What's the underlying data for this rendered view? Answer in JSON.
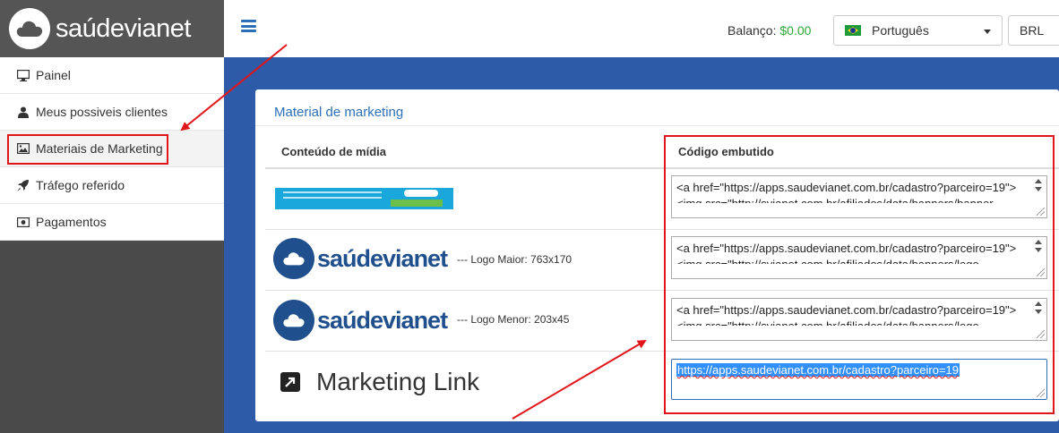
{
  "brand": {
    "name": "saúdevianet",
    "logo_icon": "cloud-icon"
  },
  "topbar": {
    "menu_icon": "hamburger-icon",
    "balance_label": "Balanço:",
    "balance_value": "$0.00",
    "language": {
      "flag": "brazil-flag-icon",
      "selected": "Português"
    },
    "currency": "BRL"
  },
  "sidebar": {
    "items": [
      {
        "label": "Painel",
        "icon": "monitor-icon"
      },
      {
        "label": "Meus possiveis clientes",
        "icon": "user-icon"
      },
      {
        "label": "Materiais de Marketing",
        "icon": "image-icon",
        "active": true
      },
      {
        "label": "Tráfego referido",
        "icon": "rocket-icon"
      },
      {
        "label": "Pagamentos",
        "icon": "money-icon"
      }
    ]
  },
  "panel": {
    "title": "Material de marketing",
    "headers": {
      "media": "Conteúdo de mídia",
      "embed": "Código embutido"
    },
    "rows": [
      {
        "media": {
          "type": "banner"
        },
        "code_lines": [
          "<a href=\"https://apps.saudevianet.com.br/cadastro?parceiro=19\">",
          "<img src=\"http://svianet.com.br/afiliados/data/banners/banner-"
        ]
      },
      {
        "media": {
          "type": "logo",
          "logo_text": "saúdevianet",
          "caption": "--- Logo Maior: 763x170"
        },
        "code_lines": [
          "<a href=\"https://apps.saudevianet.com.br/cadastro?parceiro=19\">",
          "<img src=\"http://svianet.com.br/afiliados/data/banners/logo-"
        ]
      },
      {
        "media": {
          "type": "logo",
          "logo_text": "saúdevianet",
          "caption": "--- Logo Menor: 203x45"
        },
        "code_lines": [
          "<a href=\"https://apps.saudevianet.com.br/cadastro?parceiro=19\">",
          "<img src=\"http://svianet.com.br/afiliados/data/banners/logo-"
        ]
      }
    ],
    "marketing_link": {
      "icon": "external-link-icon",
      "label": "Marketing Link",
      "url": "https://apps.saudevianet.com.br/cadastro?parceiro=19"
    }
  },
  "colors": {
    "accent": "#2d6fb6",
    "sidebar_bg": "#4a4a4a",
    "content_bg": "#2e5ba7",
    "highlight": "#e0161b",
    "balance": "#2ea836"
  }
}
